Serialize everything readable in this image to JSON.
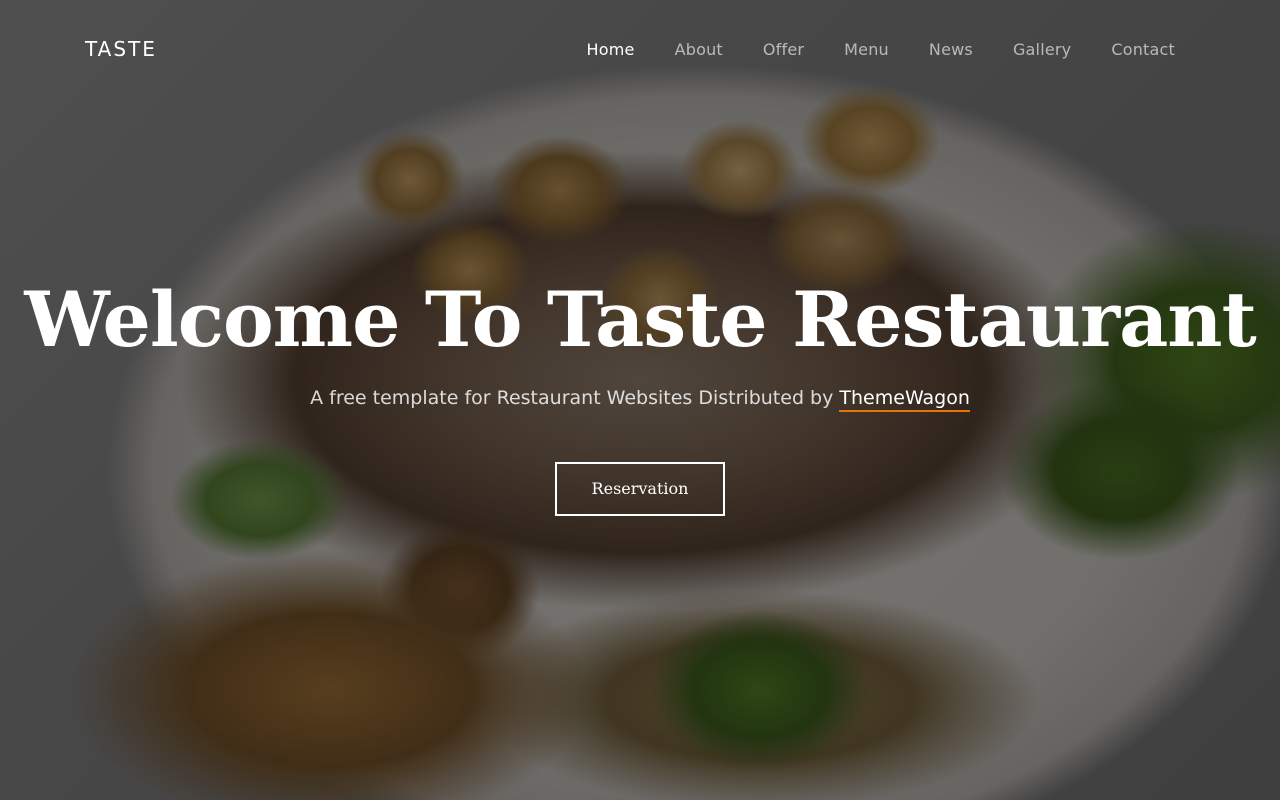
{
  "header": {
    "brand": "TASTE",
    "nav": [
      {
        "label": "Home",
        "active": true
      },
      {
        "label": "About",
        "active": false
      },
      {
        "label": "Offer",
        "active": false
      },
      {
        "label": "Menu",
        "active": false
      },
      {
        "label": "News",
        "active": false
      },
      {
        "label": "Gallery",
        "active": false
      },
      {
        "label": "Contact",
        "active": false
      }
    ]
  },
  "hero": {
    "title": "Welcome To Taste Restaurant",
    "subtitle_prefix": "A free template for Restaurant Websites Distributed by ",
    "subtitle_link": "ThemeWagon",
    "button_label": "Reservation"
  },
  "colors": {
    "accent_underline": "#e8720c",
    "text_primary": "#ffffff"
  }
}
